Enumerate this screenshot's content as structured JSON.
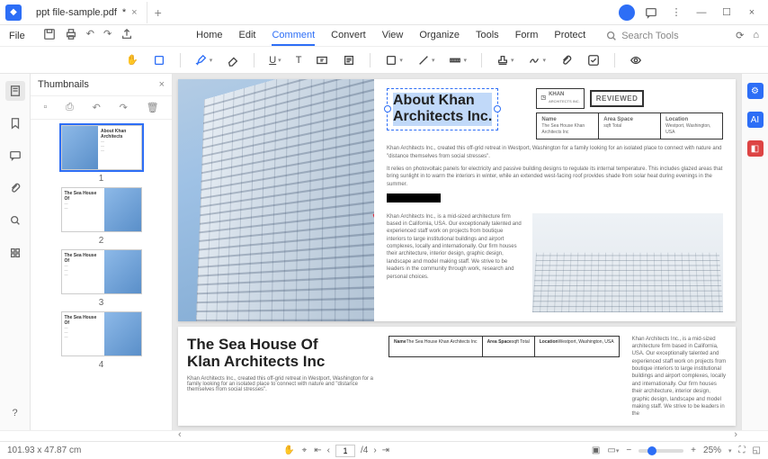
{
  "titlebar": {
    "tab_name": "ppt file-sample.pdf",
    "tab_modified": "*"
  },
  "menubar": {
    "file": "File",
    "items": [
      "Home",
      "Edit",
      "Comment",
      "Convert",
      "View",
      "Organize",
      "Tools",
      "Form",
      "Protect"
    ],
    "active_index": 2,
    "search_placeholder": "Search Tools"
  },
  "thumbnails": {
    "title": "Thumbnails",
    "pages": [
      "1",
      "2",
      "3",
      "4"
    ],
    "active": 0
  },
  "document": {
    "page1": {
      "title_line1": "About Khan",
      "title_line2": "Architects Inc.",
      "brand_name": "KHAN",
      "brand_sub": "ARCHITECTS INC.",
      "reviewed": "REVIEWED",
      "info": {
        "h1": "Name",
        "h2": "Area Space",
        "h3": "Location",
        "v1": "The Sea House Khan Architects Inc",
        "v2": "sqft Total",
        "v3": "Westport, Washington, USA"
      },
      "para1": "Khan Architects Inc., created this off-grid retreat in Westport, Washington for a family looking for an isolated place to connect with nature and \"distance themselves from social stresses\".",
      "para2": "It relies on photovoltaic panels for electricity and passive building designs to regulate its internal temperature. This includes glazed areas that bring sunlight in to warm the interiors in winter, while an extended west-facing roof provides shade from solar heat during evenings in the summer.",
      "para3": "Khan Architects Inc., is a mid-sized architecture firm based in California, USA. Our exceptionally talented and experienced staff work on projects from boutique interiors to large institutional buildings and airport complexes, locally and internationally. Our firm houses their architecture, interior design, graphic design, landscape and model making staff. We strive to be leaders in the community through work, research and personal choices."
    },
    "page2": {
      "title_line1": "The Sea House Of",
      "title_line2": "Klan Architects Inc",
      "para": "Khan Architects Inc., created this off-grid retreat in Westport, Washington for a family looking for an isolated place to connect with nature and \"distance themselves from social stresses\".",
      "info": {
        "h1": "Name",
        "h2": "Area Space",
        "h3": "Location",
        "v1": "The Sea House Khan Architects Inc",
        "v2": "sqft Total",
        "v3": "Westport, Washington, USA"
      },
      "para_right": "Khan Architects Inc., is a mid-sized architecture firm based in California, USA. Our exceptionally talented and experienced staff work on projects from boutique interiors to large institutional buildings and airport complexes, locally and internationally. Our firm houses their architecture, interior design, graphic design, landscape and model making staff. We strive to be leaders in the"
    }
  },
  "statusbar": {
    "dimensions": "101.93 x 47.87 cm",
    "page_current": "1",
    "page_total": "/4",
    "zoom": "25%"
  }
}
